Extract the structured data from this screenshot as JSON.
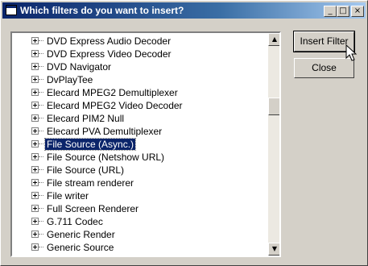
{
  "window": {
    "title": "Which filters do you want to insert?",
    "minimize_glyph": "_",
    "maximize_glyph": "□",
    "close_glyph": "×"
  },
  "filter_list": {
    "items": [
      {
        "label": "DVD Express Audio Decoder",
        "selected": false
      },
      {
        "label": "DVD Express Video Decoder",
        "selected": false
      },
      {
        "label": "DVD Navigator",
        "selected": false
      },
      {
        "label": "DvPlayTee",
        "selected": false
      },
      {
        "label": "Elecard MPEG2 Demultiplexer",
        "selected": false
      },
      {
        "label": "Elecard MPEG2 Video Decoder",
        "selected": false
      },
      {
        "label": "Elecard PIM2 Null",
        "selected": false
      },
      {
        "label": "Elecard PVA Demultiplexer",
        "selected": false
      },
      {
        "label": "File Source (Async.)",
        "selected": true
      },
      {
        "label": "File Source (Netshow URL)",
        "selected": false
      },
      {
        "label": "File Source (URL)",
        "selected": false
      },
      {
        "label": "File stream renderer",
        "selected": false
      },
      {
        "label": "File writer",
        "selected": false
      },
      {
        "label": "Full Screen Renderer",
        "selected": false
      },
      {
        "label": "G.711 Codec",
        "selected": false
      },
      {
        "label": "Generic Render",
        "selected": false
      },
      {
        "label": "Generic Source",
        "selected": false
      }
    ],
    "scroll_up_glyph": "▲",
    "scroll_down_glyph": "▼"
  },
  "buttons": {
    "insert_label": "Insert Filter",
    "close_label": "Close"
  },
  "colors": {
    "selection": "#0a246a",
    "title_gradient_start": "#0a246a",
    "title_gradient_end": "#a6caf0",
    "face": "#d4d0c8"
  }
}
